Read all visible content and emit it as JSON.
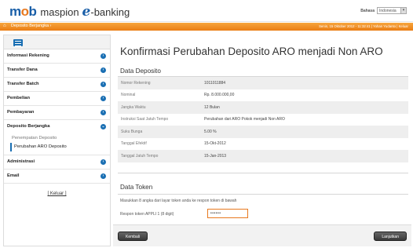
{
  "header": {
    "logo_mb": "m",
    "logo_o": "o",
    "logo_b": "b",
    "logo_maspion": "maspion",
    "logo_e": "e",
    "logo_banking": "-banking",
    "language_label": "Bahasa",
    "language_value": "Indonesia"
  },
  "breadcrumb": {
    "home_icon": "home-icon",
    "item": "Deposito Berjangka",
    "session_info": "Senin, 15 Oktober 2012 - 11:32:41 | Yohan Yudanto | Keluar"
  },
  "sidebar": {
    "items": [
      {
        "label": "Informasi Rekening"
      },
      {
        "label": "Transfer Dana"
      },
      {
        "label": "Transfer Batch"
      },
      {
        "label": "Pembelian"
      },
      {
        "label": "Pembayaran"
      },
      {
        "label": "Deposito Berjangka"
      }
    ],
    "submenu": [
      {
        "label": "Penempatan Deposito"
      },
      {
        "label": "Perubahan ARO Deposito"
      }
    ],
    "items_after": [
      {
        "label": "Administrasi"
      },
      {
        "label": "Email"
      }
    ],
    "logout": "[ Keluar ]"
  },
  "main": {
    "title": "Konfirmasi Perubahan Deposito ARO menjadi Non ARO",
    "section_deposito": "Data Deposito",
    "rows": [
      {
        "key": "Nomor Rekening",
        "value": "1011011884"
      },
      {
        "key": "Nominal",
        "value": "Rp. 8.000.000,00"
      },
      {
        "key": "Jangka Waktu",
        "value": "12 Bulan"
      },
      {
        "key": "Instruksi Saat Jatuh Tempo",
        "value": "Perubahan dari ARO Pokok menjadi Non ARO"
      },
      {
        "key": "Suku Bunga",
        "value": "5.00 %"
      },
      {
        "key": "Tanggal Efektif",
        "value": "15-Okt-2012"
      },
      {
        "key": "Tanggal Jatuh Tempo",
        "value": "15-Jan-2013"
      }
    ],
    "section_token": "Data Token",
    "token_hint": "Masukkan 8 angka dari layar token anda ke respon token di bawah",
    "token_label": "Respon token APPLI 1 (8 digit)",
    "token_value": "••••••"
  },
  "buttons": {
    "back": "Kembali",
    "next": "Lanjutkan"
  },
  "colors": {
    "brand_blue": "#1a5fa8",
    "brand_orange": "#ea7d14"
  }
}
